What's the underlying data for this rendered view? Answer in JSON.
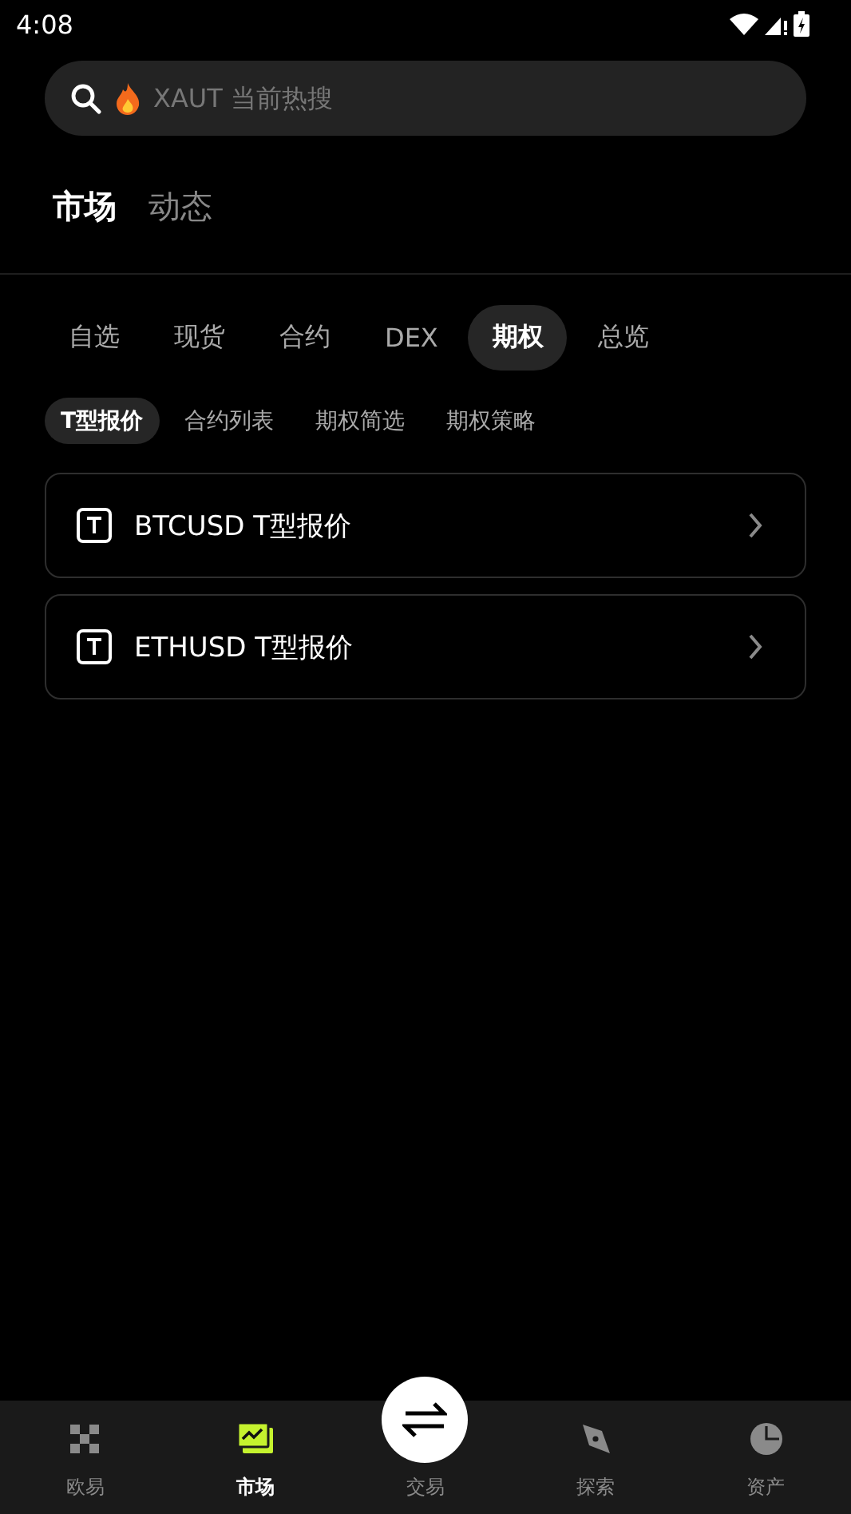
{
  "status_bar": {
    "time": "4:08"
  },
  "search": {
    "placeholder": "XAUT 当前热搜"
  },
  "top_tabs": [
    {
      "label": "市场",
      "selected": true
    },
    {
      "label": "动态",
      "selected": false
    }
  ],
  "category_tabs": [
    {
      "label": "自选",
      "selected": false
    },
    {
      "label": "现货",
      "selected": false
    },
    {
      "label": "合约",
      "selected": false
    },
    {
      "label": "DEX",
      "selected": false
    },
    {
      "label": "期权",
      "selected": true
    },
    {
      "label": "总览",
      "selected": false
    }
  ],
  "sub_tabs": [
    {
      "label": "T型报价",
      "selected": true
    },
    {
      "label": "合约列表",
      "selected": false
    },
    {
      "label": "期权简选",
      "selected": false
    },
    {
      "label": "期权策略",
      "selected": false
    }
  ],
  "list": [
    {
      "title": "BTCUSD T型报价"
    },
    {
      "title": "ETHUSD T型报价"
    }
  ],
  "bottom_nav": [
    {
      "kind": "home",
      "label": "欧易",
      "selected": false
    },
    {
      "kind": "market",
      "label": "市场",
      "selected": true
    },
    {
      "kind": "trade",
      "label": "交易",
      "selected": false
    },
    {
      "kind": "explore",
      "label": "探索",
      "selected": false
    },
    {
      "kind": "assets",
      "label": "资产",
      "selected": false
    }
  ]
}
